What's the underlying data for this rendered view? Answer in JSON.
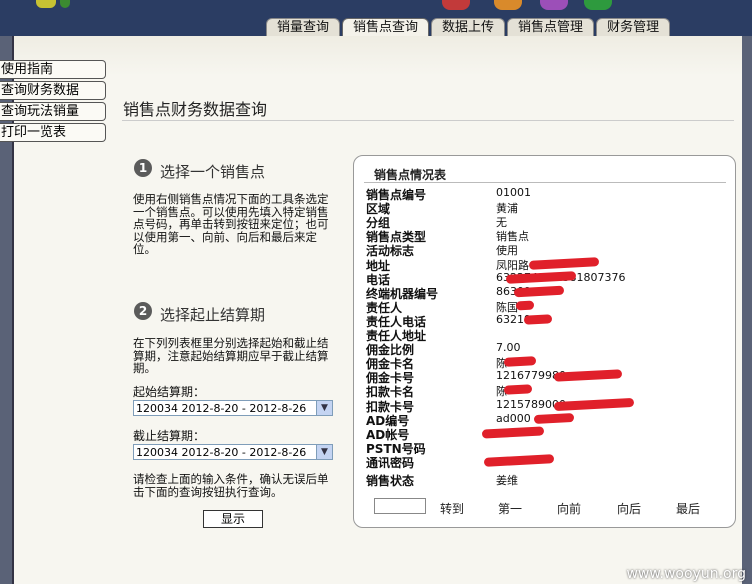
{
  "tabs": [
    "销量查询",
    "销售点查询",
    "数据上传",
    "销售点管理",
    "财务管理"
  ],
  "active_tab": 1,
  "nav": [
    "使用指南",
    "查询财务数据",
    "查询玩法销量",
    "打印一览表"
  ],
  "page_title": "销售点财务数据查询",
  "step1": {
    "num": "1",
    "title": "选择一个销售点",
    "text": "使用右侧销售点情况下面的工具条选定一个销售点。可以使用先填入特定销售点号码，再单击转到按钮来定位；也可以使用第一、向前、向后和最后来定位。"
  },
  "step2": {
    "num": "2",
    "title": "选择起止结算期",
    "text": "在下列列表框里分别选择起始和截止结算期，注意起始结算期应早于截止结算期。",
    "start_label": "起始结算期：",
    "start_value": "120034 2012-8-20 - 2012-8-26",
    "end_label": "截止结算期：",
    "end_value": "120034 2012-8-20 - 2012-8-26",
    "confirm_text": "请检查上面的输入条件，确认无误后单击下面的查询按钮执行查询。",
    "button": "显示"
  },
  "card": {
    "title": "销售点情况表",
    "rows": [
      {
        "label": "销售点编号",
        "value": "01001"
      },
      {
        "label": "区域",
        "value": "黄浦"
      },
      {
        "label": "分组",
        "value": "无"
      },
      {
        "label": "销售点类型",
        "value": "销售点"
      },
      {
        "label": "活动标志",
        "value": "使用"
      },
      {
        "label": "地址",
        "value": "凤阳路"
      },
      {
        "label": "电话",
        "value": "63227417 1381807376"
      },
      {
        "label": "终端机器编号",
        "value": "86309"
      },
      {
        "label": "责任人",
        "value": "陈国"
      },
      {
        "label": "责任人电话",
        "value": "63219"
      },
      {
        "label": "责任人地址",
        "value": ""
      },
      {
        "label": "佣金比例",
        "value": "7.00"
      },
      {
        "label": "佣金卡名",
        "value": "陈"
      },
      {
        "label": "佣金卡号",
        "value": "1216779980"
      },
      {
        "label": "扣款卡名",
        "value": "陈"
      },
      {
        "label": "扣款卡号",
        "value": "1215789000"
      },
      {
        "label": "AD编号",
        "value": "ad000"
      },
      {
        "label": "AD帐号",
        "value": ""
      },
      {
        "label": "PSTN号码",
        "value": ""
      },
      {
        "label": "通讯密码",
        "value": ""
      }
    ],
    "status_label": "销售状态",
    "status_value": "姜维",
    "nav": [
      "转到",
      "第一",
      "向前",
      "向后",
      "最后"
    ]
  },
  "watermark": "www.wooyun.org",
  "colors": {
    "topbar": "#2b3d63",
    "redaction": "#e0202a",
    "background": "#5a6277"
  }
}
